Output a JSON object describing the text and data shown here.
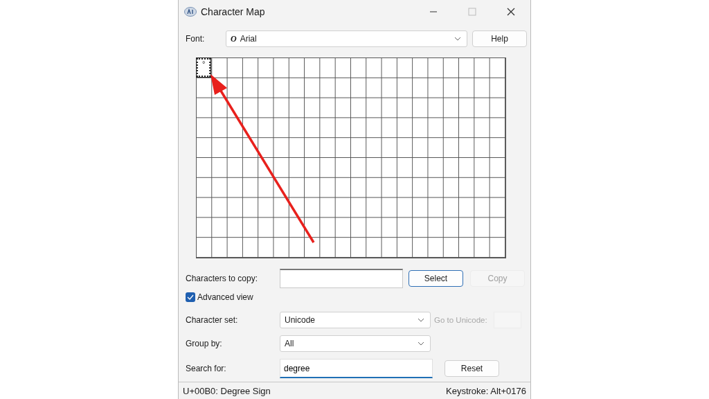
{
  "window": {
    "title": "Character Map"
  },
  "font": {
    "label": "Font:",
    "value": "Arial",
    "icon_text": "O"
  },
  "help_button": "Help",
  "characters": [
    {
      "char": "°",
      "selected": true
    }
  ],
  "copy_row": {
    "label": "Characters to copy:",
    "buttons": [
      {
        "label": "Select",
        "disabled": false
      },
      {
        "label": "Copy",
        "disabled": true
      }
    ]
  },
  "advanced_view": {
    "label": "Advanced view",
    "checked": true
  },
  "character_set": {
    "label": "Character set:",
    "value": "Unicode"
  },
  "go_to_unicode": {
    "label": "Go to Unicode:",
    "disabled": true
  },
  "group_by": {
    "label": "Group by:",
    "value": "All"
  },
  "search": {
    "label": "Search for:",
    "value": "degree",
    "button": "Reset"
  },
  "status_bar": {
    "left": "U+00B0: Degree Sign",
    "right": "Keystroke: Alt+0176"
  }
}
